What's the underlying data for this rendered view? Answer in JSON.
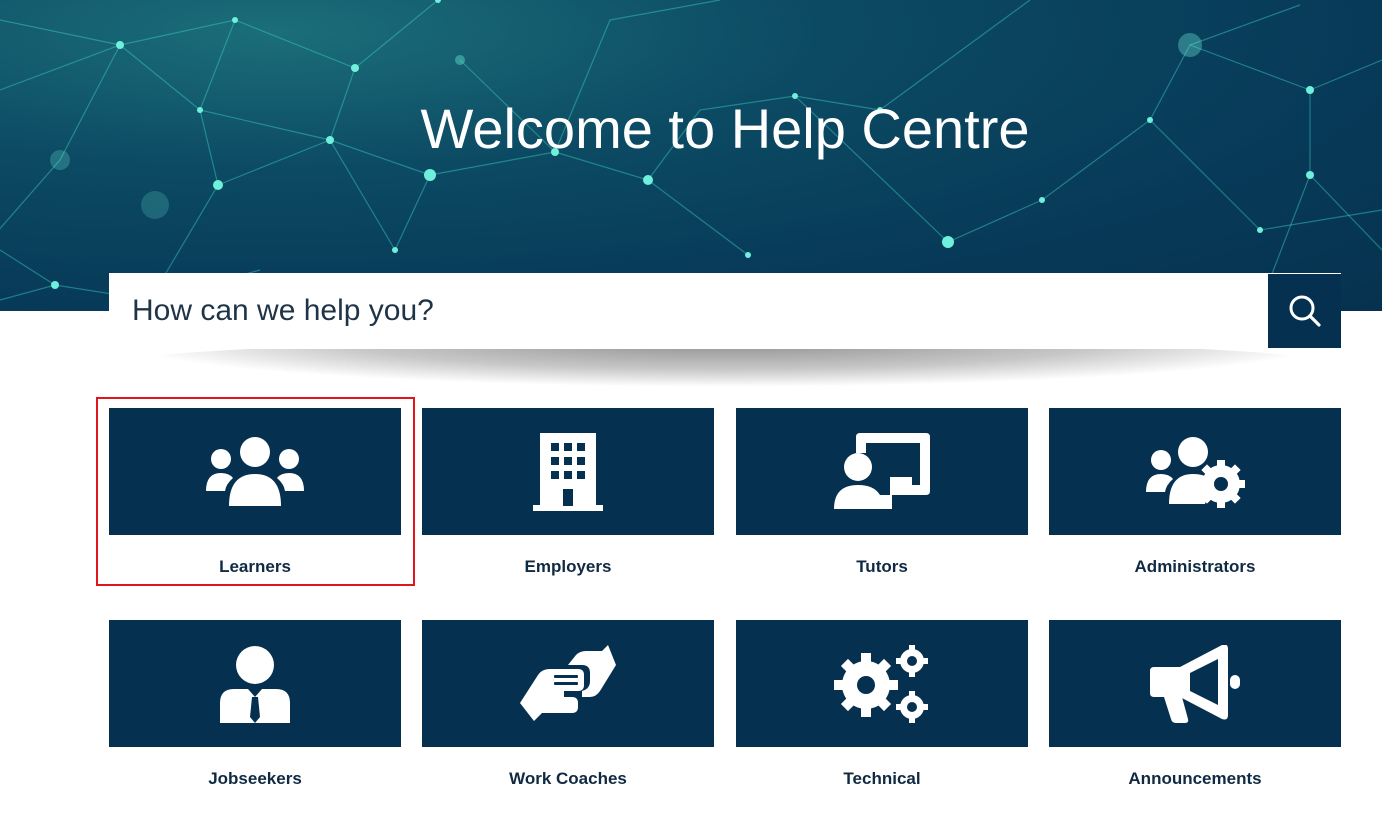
{
  "hero": {
    "title": "Welcome to Help Centre"
  },
  "search": {
    "placeholder": "How can we help you?",
    "button_icon": "search-icon"
  },
  "colors": {
    "tile_bg": "#06304f",
    "label_text": "#102a43",
    "highlight": "#e0161c"
  },
  "categories": [
    {
      "label": "Learners",
      "icon": "learners-icon",
      "selected": true
    },
    {
      "label": "Employers",
      "icon": "building-icon"
    },
    {
      "label": "Tutors",
      "icon": "teacher-board-icon"
    },
    {
      "label": "Administrators",
      "icon": "users-gear-icon"
    },
    {
      "label": "Jobseekers",
      "icon": "businessman-icon"
    },
    {
      "label": "Work Coaches",
      "icon": "handshake-icon"
    },
    {
      "label": "Technical",
      "icon": "gears-icon"
    },
    {
      "label": "Announcements",
      "icon": "megaphone-icon"
    }
  ]
}
